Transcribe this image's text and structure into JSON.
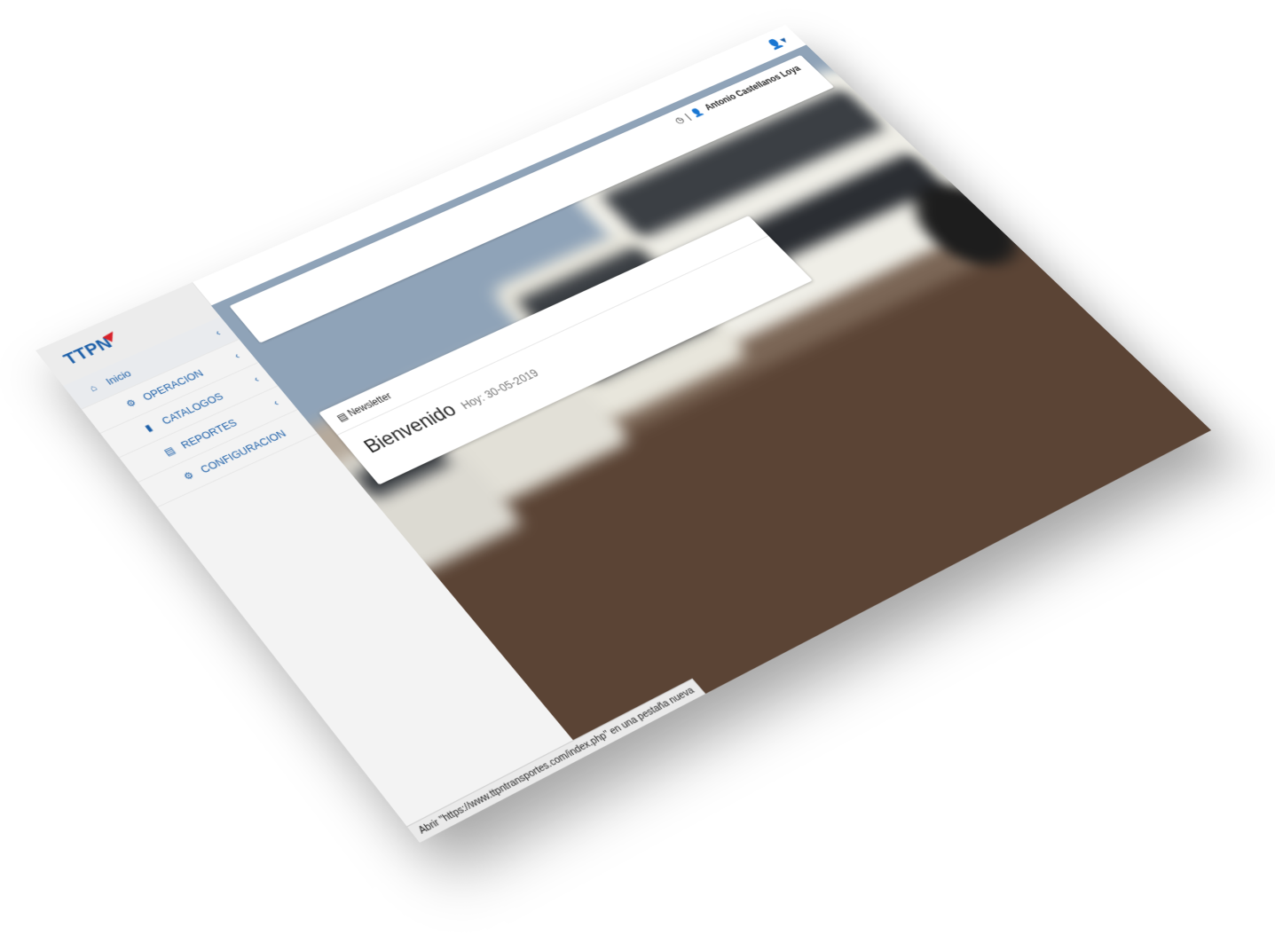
{
  "brand": {
    "logo_text": "TTPN"
  },
  "topbar": {
    "user_menu_icon": "user-icon"
  },
  "header": {
    "clock_icon": "clock-icon",
    "separator": "|",
    "user_name": "Antonio Castellanos Loya"
  },
  "sidebar": {
    "items": [
      {
        "label": "Inicio",
        "icon": "home-icon"
      },
      {
        "label": "OPERACION",
        "icon": "gear-icon"
      },
      {
        "label": "CATALOGOS",
        "icon": "book-icon"
      },
      {
        "label": "REPORTES",
        "icon": "table-icon"
      },
      {
        "label": "CONFIGURACION",
        "icon": "gears-icon"
      }
    ]
  },
  "newsletter": {
    "heading": "Newsletter",
    "title": "Bienvenido",
    "date_label": "Hoy: 30-05-2019"
  },
  "statusbar": {
    "text": "Abrir \"https://www.ttpntransportes.com/index.php\" en una pestaña nueva"
  },
  "colors": {
    "accent": "#1c5fa8",
    "logo_mark": "#d8222a",
    "sidebar_bg": "#f3f3f3"
  }
}
